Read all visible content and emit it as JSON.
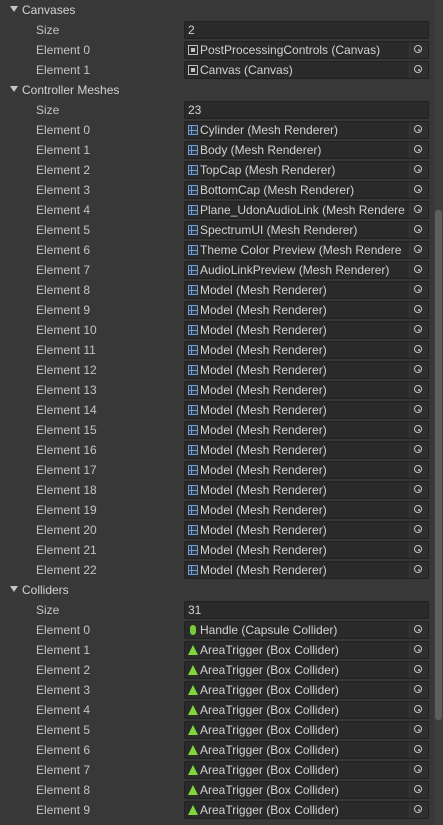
{
  "sections": [
    {
      "title": "Canvases",
      "size_label": "Size",
      "size_value": "2",
      "elements": [
        {
          "label": "Element 0",
          "value": "PostProcessingControls (Canvas)",
          "icon": "canvas-icon"
        },
        {
          "label": "Element 1",
          "value": "Canvas (Canvas)",
          "icon": "canvas-icon"
        }
      ]
    },
    {
      "title": "Controller Meshes",
      "size_label": "Size",
      "size_value": "23",
      "elements": [
        {
          "label": "Element 0",
          "value": "Cylinder (Mesh Renderer)",
          "icon": "mesh-renderer-icon"
        },
        {
          "label": "Element 1",
          "value": "Body (Mesh Renderer)",
          "icon": "mesh-renderer-icon"
        },
        {
          "label": "Element 2",
          "value": "TopCap (Mesh Renderer)",
          "icon": "mesh-renderer-icon"
        },
        {
          "label": "Element 3",
          "value": "BottomCap (Mesh Renderer)",
          "icon": "mesh-renderer-icon"
        },
        {
          "label": "Element 4",
          "value": "Plane_UdonAudioLink (Mesh Rendere",
          "icon": "mesh-renderer-icon"
        },
        {
          "label": "Element 5",
          "value": "SpectrumUI (Mesh Renderer)",
          "icon": "mesh-renderer-icon"
        },
        {
          "label": "Element 6",
          "value": "Theme Color Preview (Mesh Rendere",
          "icon": "mesh-renderer-icon"
        },
        {
          "label": "Element 7",
          "value": "AudioLinkPreview (Mesh Renderer)",
          "icon": "mesh-renderer-icon"
        },
        {
          "label": "Element 8",
          "value": "Model (Mesh Renderer)",
          "icon": "mesh-renderer-icon"
        },
        {
          "label": "Element 9",
          "value": "Model (Mesh Renderer)",
          "icon": "mesh-renderer-icon"
        },
        {
          "label": "Element 10",
          "value": "Model (Mesh Renderer)",
          "icon": "mesh-renderer-icon"
        },
        {
          "label": "Element 11",
          "value": "Model (Mesh Renderer)",
          "icon": "mesh-renderer-icon"
        },
        {
          "label": "Element 12",
          "value": "Model (Mesh Renderer)",
          "icon": "mesh-renderer-icon"
        },
        {
          "label": "Element 13",
          "value": "Model (Mesh Renderer)",
          "icon": "mesh-renderer-icon"
        },
        {
          "label": "Element 14",
          "value": "Model (Mesh Renderer)",
          "icon": "mesh-renderer-icon"
        },
        {
          "label": "Element 15",
          "value": "Model (Mesh Renderer)",
          "icon": "mesh-renderer-icon"
        },
        {
          "label": "Element 16",
          "value": "Model (Mesh Renderer)",
          "icon": "mesh-renderer-icon"
        },
        {
          "label": "Element 17",
          "value": "Model (Mesh Renderer)",
          "icon": "mesh-renderer-icon"
        },
        {
          "label": "Element 18",
          "value": "Model (Mesh Renderer)",
          "icon": "mesh-renderer-icon"
        },
        {
          "label": "Element 19",
          "value": "Model (Mesh Renderer)",
          "icon": "mesh-renderer-icon"
        },
        {
          "label": "Element 20",
          "value": "Model (Mesh Renderer)",
          "icon": "mesh-renderer-icon"
        },
        {
          "label": "Element 21",
          "value": "Model (Mesh Renderer)",
          "icon": "mesh-renderer-icon"
        },
        {
          "label": "Element 22",
          "value": "Model (Mesh Renderer)",
          "icon": "mesh-renderer-icon"
        }
      ]
    },
    {
      "title": "Colliders",
      "size_label": "Size",
      "size_value": "31",
      "elements": [
        {
          "label": "Element 0",
          "value": "Handle (Capsule Collider)",
          "icon": "capsule-collider-icon"
        },
        {
          "label": "Element 1",
          "value": "AreaTrigger (Box Collider)",
          "icon": "box-collider-icon"
        },
        {
          "label": "Element 2",
          "value": "AreaTrigger (Box Collider)",
          "icon": "box-collider-icon"
        },
        {
          "label": "Element 3",
          "value": "AreaTrigger (Box Collider)",
          "icon": "box-collider-icon"
        },
        {
          "label": "Element 4",
          "value": "AreaTrigger (Box Collider)",
          "icon": "box-collider-icon"
        },
        {
          "label": "Element 5",
          "value": "AreaTrigger (Box Collider)",
          "icon": "box-collider-icon"
        },
        {
          "label": "Element 6",
          "value": "AreaTrigger (Box Collider)",
          "icon": "box-collider-icon"
        },
        {
          "label": "Element 7",
          "value": "AreaTrigger (Box Collider)",
          "icon": "box-collider-icon"
        },
        {
          "label": "Element 8",
          "value": "AreaTrigger (Box Collider)",
          "icon": "box-collider-icon"
        },
        {
          "label": "Element 9",
          "value": "AreaTrigger (Box Collider)",
          "icon": "box-collider-icon"
        }
      ]
    }
  ],
  "picker_icon": "object-picker-icon",
  "colors": {
    "background": "#383838",
    "field": "#2a2a2a",
    "text": "#c4c4c4",
    "mesh_icon": "#6f9bd1",
    "collider_icon": "#82d43c"
  }
}
